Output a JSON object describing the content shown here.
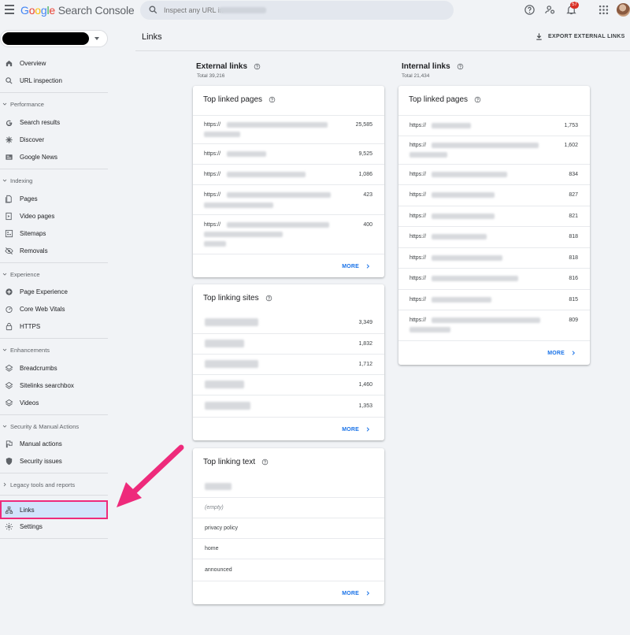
{
  "app": {
    "logo_google": [
      "G",
      "o",
      "o",
      "g",
      "l",
      "e"
    ],
    "logo_product": "Search Console",
    "search_placeholder": "Inspect any URL in",
    "notification_count": "57"
  },
  "sidebar": {
    "top_items": [
      {
        "label": "Overview",
        "icon": "home-icon"
      },
      {
        "label": "URL inspection",
        "icon": "search-icon"
      }
    ],
    "sections": [
      {
        "title": "Performance",
        "items": [
          {
            "label": "Search results",
            "icon": "google-g-icon"
          },
          {
            "label": "Discover",
            "icon": "asterisk-icon"
          },
          {
            "label": "Google News",
            "icon": "news-icon"
          }
        ]
      },
      {
        "title": "Indexing",
        "items": [
          {
            "label": "Pages",
            "icon": "pages-icon"
          },
          {
            "label": "Video pages",
            "icon": "video-pages-icon"
          },
          {
            "label": "Sitemaps",
            "icon": "sitemap-icon"
          },
          {
            "label": "Removals",
            "icon": "eye-off-icon"
          }
        ]
      },
      {
        "title": "Experience",
        "items": [
          {
            "label": "Page Experience",
            "icon": "plus-circle-icon"
          },
          {
            "label": "Core Web Vitals",
            "icon": "gauge-icon"
          },
          {
            "label": "HTTPS",
            "icon": "lock-icon"
          }
        ]
      },
      {
        "title": "Enhancements",
        "items": [
          {
            "label": "Breadcrumbs",
            "icon": "layers-icon"
          },
          {
            "label": "Sitelinks searchbox",
            "icon": "layers-icon"
          },
          {
            "label": "Videos",
            "icon": "layers-icon"
          }
        ]
      },
      {
        "title": "Security & Manual Actions",
        "items": [
          {
            "label": "Manual actions",
            "icon": "flag-icon"
          },
          {
            "label": "Security issues",
            "icon": "shield-icon"
          }
        ]
      },
      {
        "title": "Legacy tools and reports",
        "items": []
      }
    ],
    "bottom_items": [
      {
        "label": "Links",
        "icon": "links-icon",
        "active": true
      },
      {
        "label": "Settings",
        "icon": "gear-icon"
      }
    ]
  },
  "main": {
    "title": "Links",
    "export_label": "EXPORT EXTERNAL LINKS",
    "external": {
      "title": "External links",
      "total": "Total 39,216",
      "top_linked_pages": {
        "title": "Top linked pages",
        "rows": [
          {
            "prefix": "https://",
            "value": "25,585"
          },
          {
            "prefix": "https://",
            "value": "9,525"
          },
          {
            "prefix": "https://",
            "value": "1,086"
          },
          {
            "prefix": "https://",
            "value": "423"
          },
          {
            "prefix": "https://",
            "value": "400"
          }
        ],
        "more": "MORE"
      },
      "top_linking_sites": {
        "title": "Top linking sites",
        "rows": [
          {
            "value": "3,349"
          },
          {
            "value": "1,832"
          },
          {
            "value": "1,712"
          },
          {
            "value": "1,460"
          },
          {
            "value": "1,353"
          }
        ],
        "more": "MORE"
      },
      "top_linking_text": {
        "title": "Top linking text",
        "rows": [
          "",
          "(empty)",
          "privacy policy",
          "home",
          "announced"
        ],
        "more": "MORE"
      }
    },
    "internal": {
      "title": "Internal links",
      "total": "Total 21,434",
      "top_linked_pages": {
        "title": "Top linked pages",
        "rows": [
          {
            "prefix": "https://",
            "value": "1,753"
          },
          {
            "prefix": "https://",
            "value": "1,602"
          },
          {
            "prefix": "https://",
            "value": "834"
          },
          {
            "prefix": "https://",
            "value": "827"
          },
          {
            "prefix": "https://",
            "value": "821"
          },
          {
            "prefix": "https://",
            "value": "818"
          },
          {
            "prefix": "https://",
            "value": "818"
          },
          {
            "prefix": "https://",
            "value": "816"
          },
          {
            "prefix": "https://",
            "value": "815"
          },
          {
            "prefix": "https://",
            "value": "809"
          }
        ],
        "more": "MORE"
      }
    }
  },
  "colors": {
    "accent": "#1a73e8",
    "active_nav_bg": "#d2e3fc",
    "annotation": "#ee2a7b",
    "badge": "#d93025"
  }
}
